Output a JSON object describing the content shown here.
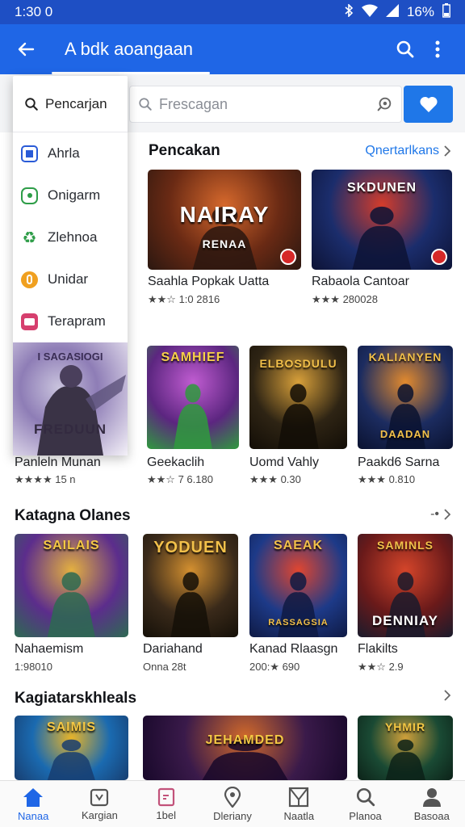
{
  "status": {
    "time": "1:30 0",
    "battery": "16%"
  },
  "appbar": {
    "title": "A  bdk aoangaan"
  },
  "search": {
    "placeholder": "Frescagan"
  },
  "dropdown": {
    "search_label": "Pencarjan",
    "items": [
      {
        "label": "Ahrla",
        "icon": "square-icon",
        "color": "#2a5bd7"
      },
      {
        "label": "Onigarm",
        "icon": "shield-icon",
        "color": "#2e9d48"
      },
      {
        "label": "Zlehnoa",
        "icon": "recycle-icon",
        "color": "#2e9d48"
      },
      {
        "label": "Unidar",
        "icon": "coin-icon",
        "color": "#f0a020"
      },
      {
        "label": "Terapram",
        "icon": "card-icon",
        "color": "#d63f6e"
      }
    ],
    "banner_top": "I  SAGASIOGI",
    "banner_bottom": "FREDUUN"
  },
  "section1": {
    "title": "Pencakan",
    "see_all": "Qnertarlkans",
    "cards": [
      {
        "title": "Saahla Popkak Uatta",
        "rating": "★★☆ 1:0 2816",
        "art_top": "NAIRAY",
        "art_bottom": "RENAA",
        "colors": [
          "#6a2a14",
          "#d5682c",
          "#2b1710"
        ]
      },
      {
        "title": "Rabaola Cantoar",
        "rating": "★★★ 280028",
        "art_top": "SKDUNEN",
        "art_bottom": "",
        "colors": [
          "#1b2d6c",
          "#d33c2b",
          "#0d1336"
        ]
      }
    ]
  },
  "section1b": {
    "cards": [
      {
        "title": "Panleln Munan",
        "rating": "★★★★ 15 n",
        "art_top": "",
        "art_bottom": "",
        "colors": [
          "#888",
          "#888",
          "#888"
        ]
      },
      {
        "title": "Geekaclih",
        "rating": "★★☆ 7 6.180",
        "art_top": "SAMHIEF",
        "art_bottom": "",
        "colors": [
          "#5c2680",
          "#c05cd1",
          "#2f9a3e"
        ]
      },
      {
        "title": "Uomd Vahly",
        "rating": "★★★ 0.30",
        "art_top": "ELBOSDULU",
        "art_bottom": "",
        "colors": [
          "#2e2414",
          "#d8a03a",
          "#120d06"
        ]
      },
      {
        "title": "Paakd6 Sarna",
        "rating": "★★★ 0.810",
        "art_top": "KALIANYEN",
        "art_bottom": "DAADAN",
        "colors": [
          "#1c2c60",
          "#e28a2e",
          "#0a1230"
        ]
      }
    ]
  },
  "section2": {
    "title": "Katagna Olanes",
    "arrows": "-• ",
    "cards": [
      {
        "title": "Nahaemism",
        "meta": "1:98010",
        "art_top": "SAILAIS",
        "colors": [
          "#5c2d8c",
          "#e4b040",
          "#2d6a52"
        ]
      },
      {
        "title": "Dariahand",
        "meta": "Onna 28t",
        "art_top": "YODUEN",
        "colors": [
          "#3a2a1a",
          "#d49030",
          "#151008"
        ]
      },
      {
        "title": "Kanad Rlaasgn",
        "meta": "200:★ 690",
        "art_top": "SAEAK",
        "art_bottom": "RASSAGSIA",
        "colors": [
          "#1d3a88",
          "#e04630",
          "#0f1a44"
        ]
      },
      {
        "title": "Flakilts",
        "meta": "★★☆ 2.9",
        "art_top": "SAMINLS",
        "art_bottom": "DENNIAY",
        "colors": [
          "#6a1a1a",
          "#d4452a",
          "#1a1b2c"
        ]
      }
    ]
  },
  "section3": {
    "title": "Kagiatarskhleals",
    "cards": [
      {
        "art_top": "SAIMIS",
        "colors": [
          "#1a6ab0",
          "#e8b428",
          "#183e70"
        ]
      },
      {
        "art_top": "JEHAMDED",
        "colors": [
          "#3a1a4a",
          "#d26a2a",
          "#18082a"
        ]
      },
      {
        "art_top": "YHMIR",
        "colors": [
          "#1a4a34",
          "#d0a03a",
          "#0c2218"
        ]
      }
    ]
  },
  "nav": [
    {
      "label": "Nanaa",
      "icon": "home-icon",
      "active": true
    },
    {
      "label": "Kargian",
      "icon": "calendar-icon",
      "active": false
    },
    {
      "label": "1bel",
      "icon": "tag-icon",
      "active": false
    },
    {
      "label": "Dleriany",
      "icon": "location-icon",
      "active": false
    },
    {
      "label": "Naatla",
      "icon": "map-icon",
      "active": false
    },
    {
      "label": "Planoa",
      "icon": "search-icon",
      "active": false
    },
    {
      "label": "Basoaa",
      "icon": "person-icon",
      "active": false
    }
  ],
  "colors": {
    "primary": "#1f66e6",
    "status": "#1e4fc4",
    "accent": "#1f77e8",
    "star": "#f4b400"
  }
}
